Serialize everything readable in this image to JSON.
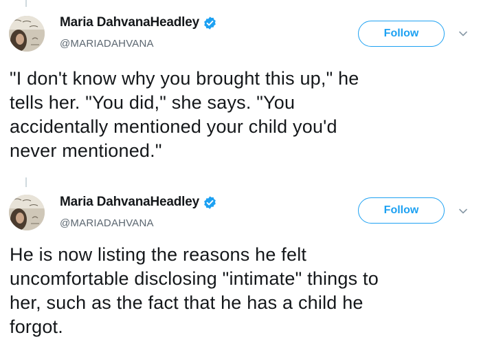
{
  "colors": {
    "accent": "#1da1f2",
    "text": "#14171a",
    "secondary": "#5b6670",
    "thread_line": "#cfd9de"
  },
  "tweets": [
    {
      "author": {
        "display_name": "Maria DahvanaHeadley",
        "handle": "@MARIADAHVANA",
        "verified_icon": "verified-badge-icon",
        "avatar": "avatar-image"
      },
      "follow_label": "Follow",
      "menu_icon": "chevron-down-icon",
      "text": "\"I don't know why you brought this up,\" he\ntells her. \"You did,\" she says. \"You\naccidentally mentioned your child you'd\nnever mentioned.\""
    },
    {
      "author": {
        "display_name": "Maria DahvanaHeadley",
        "handle": "@MARIADAHVANA",
        "verified_icon": "verified-badge-icon",
        "avatar": "avatar-image"
      },
      "follow_label": "Follow",
      "menu_icon": "chevron-down-icon",
      "text": "He is now listing the reasons he felt\nuncomfortable disclosing \"intimate\" things to\nher, such as the fact that he has a child he\nforgot."
    }
  ]
}
